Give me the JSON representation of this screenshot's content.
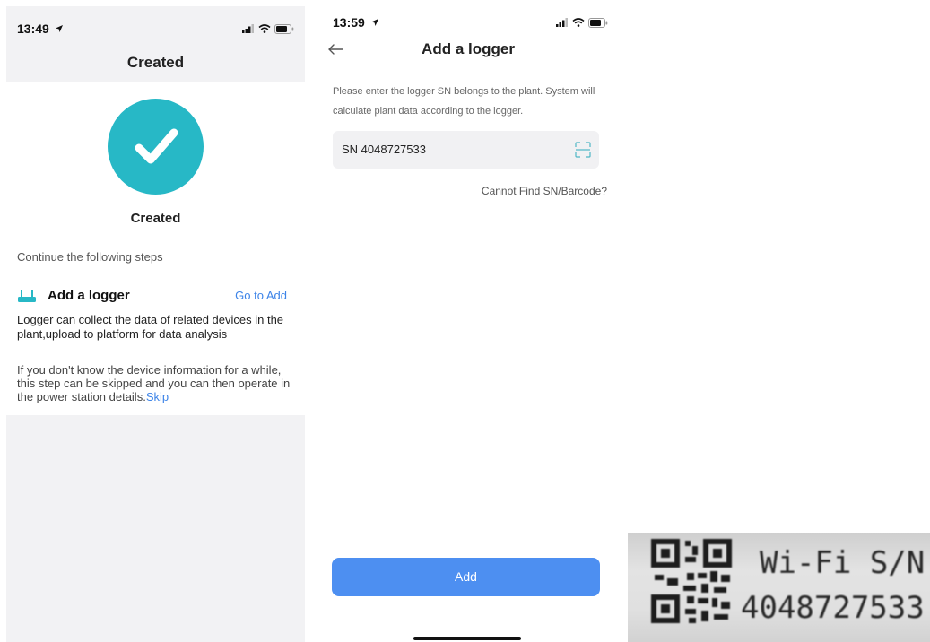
{
  "created_screen": {
    "status_time": "13:49",
    "title": "Created",
    "success_label": "Created",
    "continue_text": "Continue the following steps",
    "logger_title": "Add a logger",
    "go_to_add": "Go to Add",
    "logger_description": "Logger can collect the data of related devices in the plant,upload to platform for data analysis",
    "skip_note": "If you don't know the device information for a while, this step can be skipped and you can then operate in the power station details.",
    "skip_link": "Skip"
  },
  "add_logger_screen": {
    "status_time": "13:59",
    "title": "Add a logger",
    "instruction": "Please enter the logger SN belongs to the plant. System will calculate plant data according to the logger.",
    "sn_value": "SN 4048727533",
    "cannot_find": "Cannot Find SN/Barcode?",
    "add_button": "Add"
  },
  "label_photo": {
    "line1": "Wi-Fi S/N:",
    "line2": "4048727533"
  },
  "colors": {
    "accent_blue": "#4d8ff1",
    "link_blue": "#3d84e8",
    "success_teal": "#27b8c6",
    "panel_gray": "#f2f2f4"
  },
  "icons": {
    "success": "check-icon",
    "logger": "router-icon",
    "back": "arrow-left-icon",
    "scan": "scan-icon",
    "location": "location-arrow-icon",
    "signal": "signal-icon",
    "wifi": "wifi-icon",
    "battery": "battery-icon"
  }
}
